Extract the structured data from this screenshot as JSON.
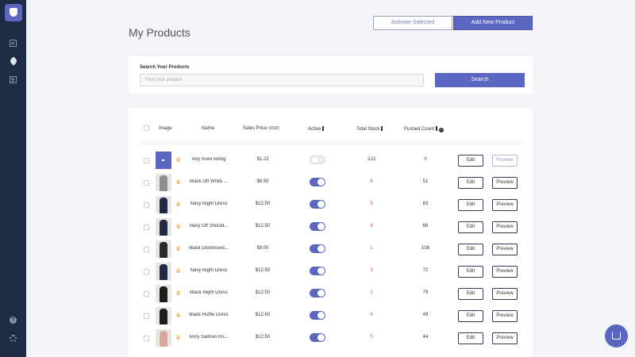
{
  "header": {
    "title": "My Products",
    "activate_selected": "Activate Selected",
    "add_new_product": "Add New Product"
  },
  "search": {
    "label": "Search Your Products",
    "placeholder": "Find your product",
    "button": "Search"
  },
  "table": {
    "columns": {
      "image": "Image",
      "name": "Name",
      "price": "Sales Price",
      "price_unit": "(USD)",
      "active": "Active",
      "total_stock": "Total Stock",
      "pushed_count": "Pushed Count"
    },
    "edit_label": "Edit",
    "preview_label": "Preview",
    "rows": [
      {
        "name": "Any more listing",
        "price": "$1.23",
        "active": false,
        "stock": "213",
        "pushed": "0",
        "thumb": "placeholder",
        "preview_disabled": true
      },
      {
        "name": "Black Off White ...",
        "price": "$8.50",
        "active": true,
        "stock": "6",
        "pushed": "51",
        "thumb": "#8c8f8a"
      },
      {
        "name": "Navy Night Dress",
        "price": "$12.50",
        "active": true,
        "stock": "5",
        "pushed": "63",
        "thumb": "#1f2a44"
      },
      {
        "name": "Navy Off Should...",
        "price": "$12.50",
        "active": true,
        "stock": "6",
        "pushed": "66",
        "thumb": "#1f2a44"
      },
      {
        "name": "Black Distressed...",
        "price": "$9.00",
        "active": true,
        "stock": "1",
        "pushed": "108",
        "thumb": "#2a2a2a"
      },
      {
        "name": "Navy Night Dress",
        "price": "$12.50",
        "active": true,
        "stock": "3",
        "pushed": "72",
        "thumb": "#1f2a44"
      },
      {
        "name": "Black Night Dress",
        "price": "$12.50",
        "active": true,
        "stock": "2",
        "pushed": "79",
        "thumb": "#1c1c1c"
      },
      {
        "name": "Black Ruffle Dress",
        "price": "$12.60",
        "active": true,
        "stock": "6",
        "pushed": "49",
        "thumb": "#1c1c1c"
      },
      {
        "name": "Ivory Salmon Ro...",
        "price": "$12.50",
        "active": true,
        "stock": "5",
        "pushed": "44",
        "thumb": "#d9a89a"
      }
    ]
  },
  "colors": {
    "accent": "#5b66c0",
    "sidebar": "#1e2b45",
    "low_stock": "#d9534f"
  }
}
